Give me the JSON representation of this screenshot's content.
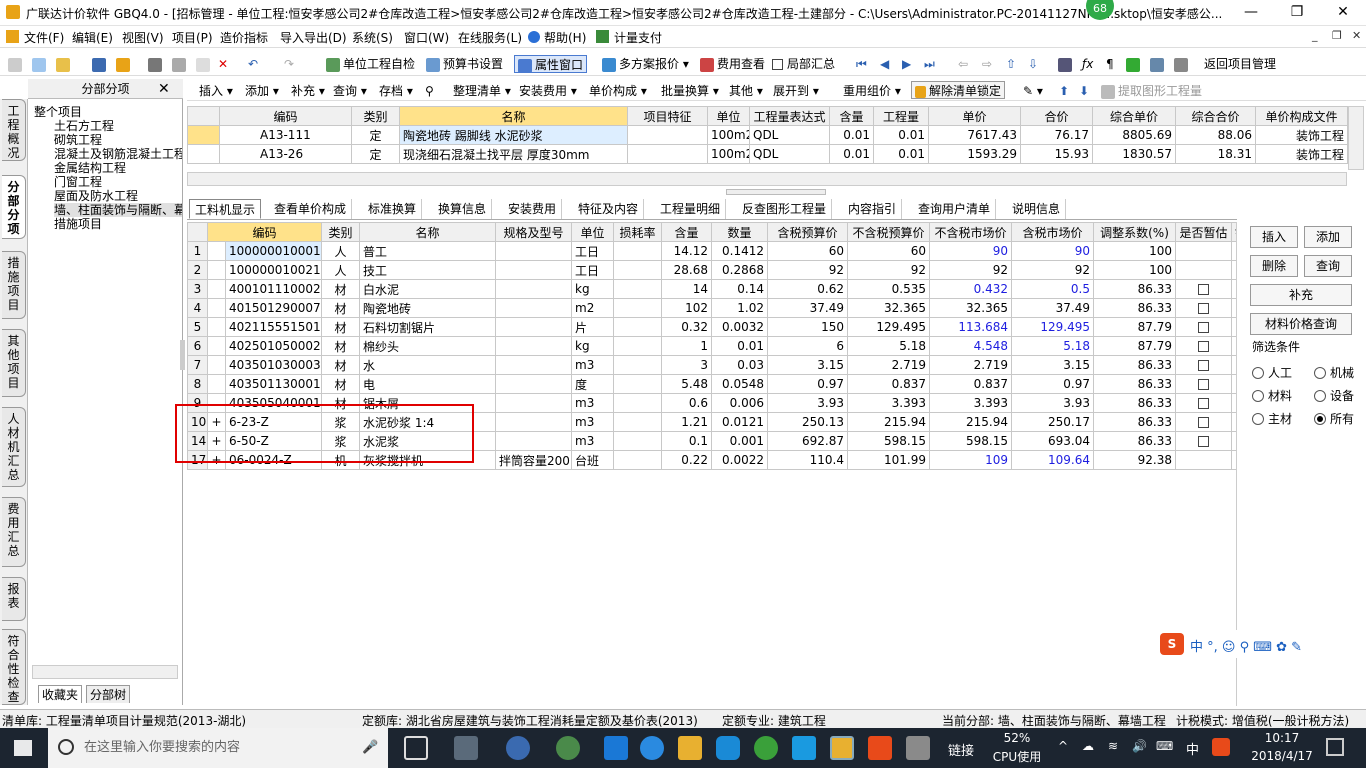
{
  "window": {
    "title": "广联达计价软件 GBQ4.0 - [招标管理 - 单位工程:恒安孝感公司2#仓库改造工程>恒安孝感公司2#仓库改造工程>恒安孝感公司2#仓库改造工程-土建部分 - C:\\Users\\Administrator.PC-20141127NRh...sktop\\恒安孝感公...",
    "badge": "68",
    "minimize": "—",
    "restore": "❐",
    "close": "✕",
    "mdi_controls": [
      "_",
      "❐",
      "✕"
    ]
  },
  "menubar": [
    "文件(F)",
    "编辑(E)",
    "视图(V)",
    "项目(P)",
    "造价指标",
    "导入导出(D)",
    "系统(S)",
    "窗口(W)",
    "在线服务(L)",
    "帮助(H)",
    "计量支付"
  ],
  "toolbar": {
    "check": "单位工程自检",
    "budget_setting": "预算书设置",
    "property_window": "属性窗口",
    "multi_quote": "多方案报价",
    "fee_view": "费用查看",
    "partial_sum": "局部汇总",
    "back": "返回项目管理"
  },
  "vtabs": [
    "工程概况",
    "分部分项",
    "措施项目",
    "其他项目",
    "人材机汇总",
    "费用汇总",
    "报表",
    "符合性检查"
  ],
  "left_panel": {
    "title": "分部分项",
    "close": "✕",
    "tree": [
      "整个项目",
      "土石方工程",
      "砌筑工程",
      "混凝土及钢筋混凝土工程",
      "金属结构工程",
      "门窗工程",
      "屋面及防水工程",
      "墙、柱面装饰与隔断、幕墙工程",
      "措施项目"
    ],
    "bottom_tabs": [
      "收藏夹",
      "分部树"
    ]
  },
  "parts_toolbar": [
    "插入",
    "添加",
    "补充",
    "查询",
    "存档",
    "整理清单",
    "安装费用",
    "单价构成",
    "批量换算",
    "其他",
    "展开到",
    "重用组价",
    "解除清单锁定",
    "提取图形工程量"
  ],
  "upper_table": {
    "headers": [
      "编码",
      "类别",
      "名称",
      "项目特征",
      "单位",
      "工程量表达式",
      "含量",
      "工程量",
      "单价",
      "合价",
      "综合单价",
      "综合合价",
      "单价构成文件"
    ],
    "rows": [
      [
        "A13-111",
        "定",
        "陶瓷地砖 踢脚线 水泥砂浆",
        "",
        "100m2",
        "QDL",
        "0.01",
        "0.01",
        "7617.43",
        "76.17",
        "8805.69",
        "88.06",
        "装饰工程"
      ],
      [
        "A13-26",
        "定",
        "现浇细石混凝土找平层 厚度30mm",
        "",
        "100m2",
        "QDL",
        "0.01",
        "0.01",
        "1593.29",
        "15.93",
        "1830.57",
        "18.31",
        "装饰工程"
      ]
    ]
  },
  "detail_tabs": [
    "工料机显示",
    "查看单价构成",
    "标准换算",
    "换算信息",
    "安装费用",
    "特征及内容",
    "工程量明细",
    "反查图形工程量",
    "内容指引",
    "查询用户清单",
    "说明信息"
  ],
  "lower_table": {
    "headers": [
      "编码",
      "类别",
      "名称",
      "规格及型号",
      "单位",
      "损耗率",
      "含量",
      "数量",
      "含税预算价",
      "不含税预算价",
      "不含税市场价",
      "含税市场价",
      "调整系数(%)",
      "是否暂估",
      "锁定"
    ],
    "rows": [
      {
        "no": "1",
        "exp": "",
        "code": "100000010001",
        "type": "人",
        "name": "普工",
        "spec": "",
        "unit": "工日",
        "loss": "",
        "content": "14.12",
        "qty": "0.1412",
        "tax_budget": "60",
        "notax_budget": "60",
        "notax_market": "90",
        "tax_market": "90",
        "coef": "100",
        "est": false,
        "hl": true
      },
      {
        "no": "2",
        "exp": "",
        "code": "100000010021",
        "type": "人",
        "name": "技工",
        "spec": "",
        "unit": "工日",
        "loss": "",
        "content": "28.68",
        "qty": "0.2868",
        "tax_budget": "92",
        "notax_budget": "92",
        "notax_market": "92",
        "tax_market": "92",
        "coef": "100",
        "est": false,
        "hl": false
      },
      {
        "no": "3",
        "exp": "",
        "code": "400101110002-Z",
        "type": "材",
        "name": "白水泥",
        "spec": "",
        "unit": "kg",
        "loss": "",
        "content": "14",
        "qty": "0.14",
        "tax_budget": "0.62",
        "notax_budget": "0.535",
        "notax_market": "0.432",
        "tax_market": "0.5",
        "coef": "86.33",
        "est": true,
        "hl": true
      },
      {
        "no": "4",
        "exp": "",
        "code": "401501290007",
        "type": "材",
        "name": "陶瓷地砖",
        "spec": "",
        "unit": "m2",
        "loss": "",
        "content": "102",
        "qty": "1.02",
        "tax_budget": "37.49",
        "notax_budget": "32.365",
        "notax_market": "32.365",
        "tax_market": "37.49",
        "coef": "86.33",
        "est": true,
        "hl": false
      },
      {
        "no": "5",
        "exp": "",
        "code": "402115551501",
        "type": "材",
        "name": "石料切割锯片",
        "spec": "",
        "unit": "片",
        "loss": "",
        "content": "0.32",
        "qty": "0.0032",
        "tax_budget": "150",
        "notax_budget": "129.495",
        "notax_market": "113.684",
        "tax_market": "129.495",
        "coef": "87.79",
        "est": true,
        "hl": true
      },
      {
        "no": "6",
        "exp": "",
        "code": "402501050002-Z",
        "type": "材",
        "name": "棉纱头",
        "spec": "",
        "unit": "kg",
        "loss": "",
        "content": "1",
        "qty": "0.01",
        "tax_budget": "6",
        "notax_budget": "5.18",
        "notax_market": "4.548",
        "tax_market": "5.18",
        "coef": "87.79",
        "est": true,
        "hl": true
      },
      {
        "no": "7",
        "exp": "",
        "code": "403501030003-Z",
        "type": "材",
        "name": "水",
        "spec": "",
        "unit": "m3",
        "loss": "",
        "content": "3",
        "qty": "0.03",
        "tax_budget": "3.15",
        "notax_budget": "2.719",
        "notax_market": "2.719",
        "tax_market": "3.15",
        "coef": "86.33",
        "est": true,
        "hl": false
      },
      {
        "no": "8",
        "exp": "",
        "code": "403501130001-Z",
        "type": "材",
        "name": "电",
        "spec": "",
        "unit": "度",
        "loss": "",
        "content": "5.48",
        "qty": "0.0548",
        "tax_budget": "0.97",
        "notax_budget": "0.837",
        "notax_market": "0.837",
        "tax_market": "0.97",
        "coef": "86.33",
        "est": true,
        "hl": false
      },
      {
        "no": "9",
        "exp": "",
        "code": "403505040001-Z",
        "type": "材",
        "name": "锯木屑",
        "spec": "",
        "unit": "m3",
        "loss": "",
        "content": "0.6",
        "qty": "0.006",
        "tax_budget": "3.93",
        "notax_budget": "3.393",
        "notax_market": "3.393",
        "tax_market": "3.93",
        "coef": "86.33",
        "est": true,
        "hl": false
      },
      {
        "no": "10",
        "exp": "+",
        "code": "6-23-Z",
        "type": "浆",
        "name": "水泥砂浆 1:4",
        "spec": "",
        "unit": "m3",
        "loss": "",
        "content": "1.21",
        "qty": "0.0121",
        "tax_budget": "250.13",
        "notax_budget": "215.94",
        "notax_market": "215.94",
        "tax_market": "250.17",
        "coef": "86.33",
        "est": true,
        "hl": false
      },
      {
        "no": "14",
        "exp": "+",
        "code": "6-50-Z",
        "type": "浆",
        "name": "水泥浆",
        "spec": "",
        "unit": "m3",
        "loss": "",
        "content": "0.1",
        "qty": "0.001",
        "tax_budget": "692.87",
        "notax_budget": "598.15",
        "notax_market": "598.15",
        "tax_market": "693.04",
        "coef": "86.33",
        "est": true,
        "hl": false
      },
      {
        "no": "17",
        "exp": "+",
        "code": "06-0024-Z",
        "type": "机",
        "name": "灰浆搅拌机",
        "spec": "拌筒容量200",
        "unit": "台班",
        "loss": "",
        "content": "0.22",
        "qty": "0.0022",
        "tax_budget": "110.4",
        "notax_budget": "101.99",
        "notax_market": "109",
        "tax_market": "109.64",
        "coef": "92.38",
        "est": false,
        "hl": true
      }
    ]
  },
  "right_panel": {
    "insert": "插入",
    "add": "添加",
    "delete": "删除",
    "query": "查询",
    "supplement": "补充",
    "material_price_query": "材料价格查询",
    "filter_title": "筛选条件",
    "filters": [
      {
        "label": "人工",
        "checked": false
      },
      {
        "label": "机械",
        "checked": false
      },
      {
        "label": "材料",
        "checked": false
      },
      {
        "label": "设备",
        "checked": false
      },
      {
        "label": "主材",
        "checked": false
      },
      {
        "label": "所有",
        "checked": true
      }
    ]
  },
  "statusbar": {
    "bill_lib": "清单库:  工程量清单项目计量规范(2013-湖北)",
    "quota_lib": "定额库:  湖北省房屋建筑与装饰工程消耗量定额及基价表(2013)",
    "quota_major": "定额专业:  建筑工程",
    "current_part": "当前分部:  墙、柱面装饰与隔断、幕墙工程",
    "tax_mode": "计税模式:  增值税(一般计税方法)"
  },
  "ime": "中 °, ☺ ⚲ ⌨ ✿ ✎",
  "taskbar": {
    "search_placeholder": "在这里输入你要搜索的内容",
    "link": "链接",
    "cpu_percent": "52%",
    "cpu_label": "CPU使用",
    "ime": "中",
    "time": "10:17",
    "date": "2018/4/17"
  },
  "colors": {
    "accent_blue": "#1e1ee0",
    "highlight_box": "#e00000",
    "selected_header": "#ffe28a"
  }
}
